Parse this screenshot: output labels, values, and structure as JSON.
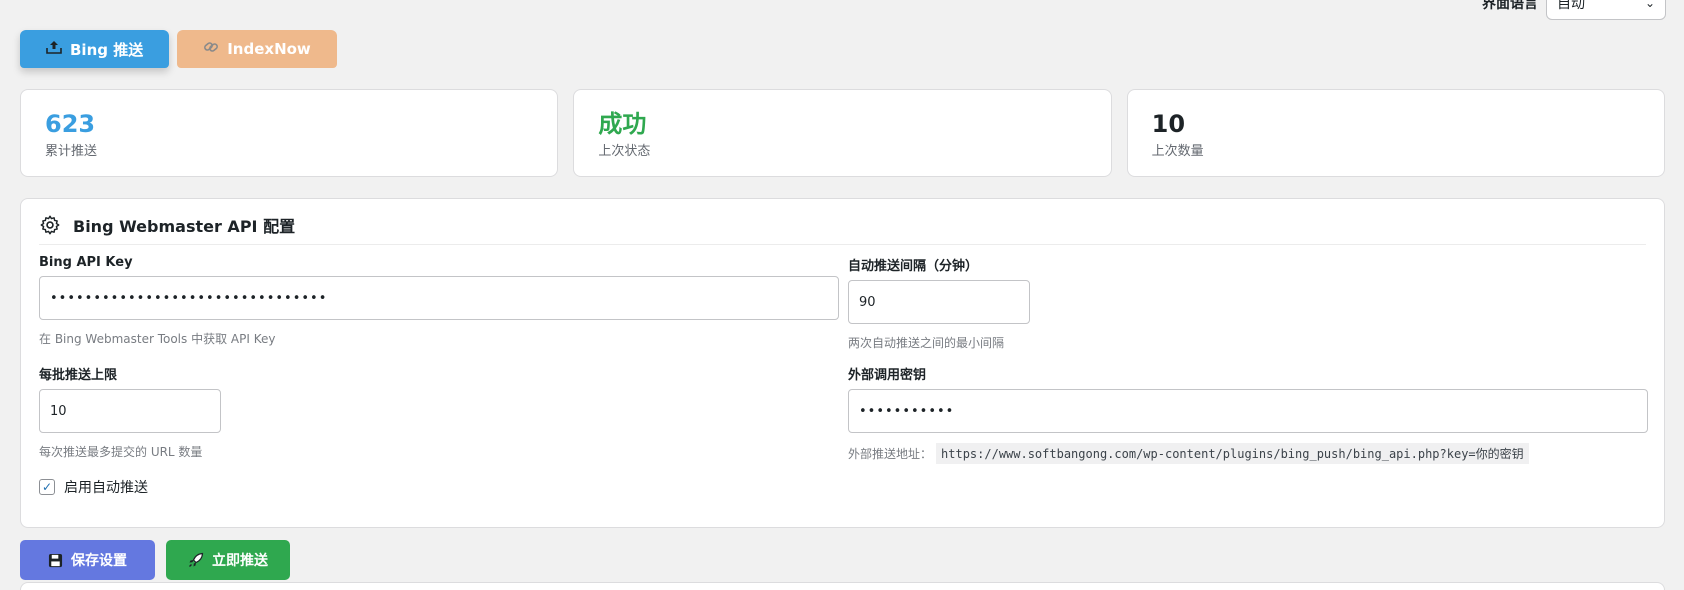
{
  "lang": {
    "label": "界面语言",
    "value": "自动"
  },
  "tabs": [
    {
      "label": "Bing 推送",
      "icon": "upload-tray-icon"
    },
    {
      "label": "IndexNow",
      "icon": "link-icon"
    }
  ],
  "stats": [
    {
      "value": "623",
      "label": "累计推送",
      "color": "#3a9ee0"
    },
    {
      "value": "成功",
      "label": "上次状态",
      "color": "#2fa84f"
    },
    {
      "value": "10",
      "label": "上次数量",
      "color": "#1d2327"
    }
  ],
  "panel": {
    "title": "Bing Webmaster API 配置",
    "api_key": {
      "label": "Bing API Key",
      "value": "••••••••••••••••••••••••••••••••",
      "help": "在 Bing Webmaster Tools 中获取 API Key"
    },
    "interval": {
      "label": "自动推送间隔（分钟）",
      "value": "90",
      "help": "两次自动推送之间的最小间隔"
    },
    "batch": {
      "label": "每批推送上限",
      "value": "10",
      "help": "每次推送最多提交的 URL 数量"
    },
    "secret": {
      "label": "外部调用密钥",
      "value": "•••••••••••",
      "help_prefix": "外部推送地址：",
      "help_url": "https://www.softbangong.com/wp-content/plugins/bing_push/bing_api.php?key=你的密钥"
    },
    "auto_enable": {
      "label": "启用自动推送",
      "checked": true
    }
  },
  "actions": {
    "save": "保存设置",
    "push": "立即推送"
  }
}
